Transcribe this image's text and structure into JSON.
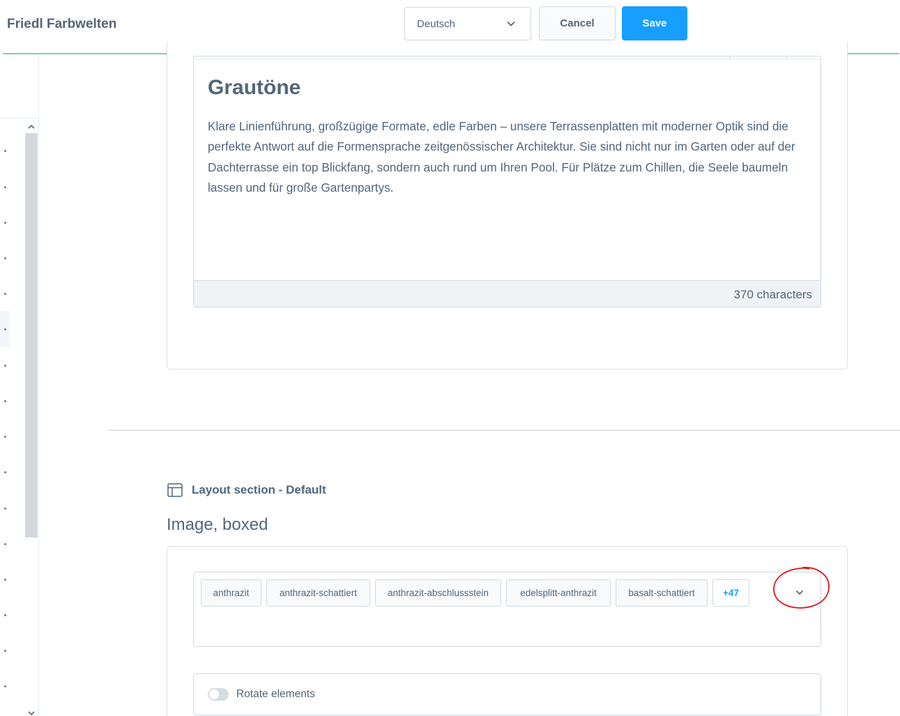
{
  "header": {
    "app_title": "Friedl Farbwelten",
    "language_value": "Deutsch",
    "cancel_label": "Cancel",
    "save_label": "Save"
  },
  "editor": {
    "heading": "Grautöne",
    "body": "Klare Linienführung, großzügige Formate, edle Farben – unsere Terrassenplatten mit moderner Optik sind die perfekte Antwort auf die Formensprache zeitgenössischer Architektur. Sie sind nicht nur im Garten oder auf der Dachterrasse ein top Blickfang, sondern auch rund um Ihren Pool. Für Plätze zum Chillen, die Seele baumeln lassen und für große Gartenpartys.",
    "char_count": "370 characters"
  },
  "section": {
    "layout_label": "Layout section - Default",
    "block_title": "Image, boxed"
  },
  "tags": {
    "items": [
      "anthrazit",
      "anthrazit-schattiert",
      "anthrazit-abschlussstein",
      "edelsplitt-anthrazit",
      "basalt-schattiert"
    ],
    "more": "+47"
  },
  "options": {
    "rotate_label": "Rotate elements",
    "rotate_enabled": false
  },
  "colors": {
    "accent": "#189eff",
    "header_line": "#7ed3a8",
    "text": "#52667a",
    "annotation": "#e0161c"
  }
}
